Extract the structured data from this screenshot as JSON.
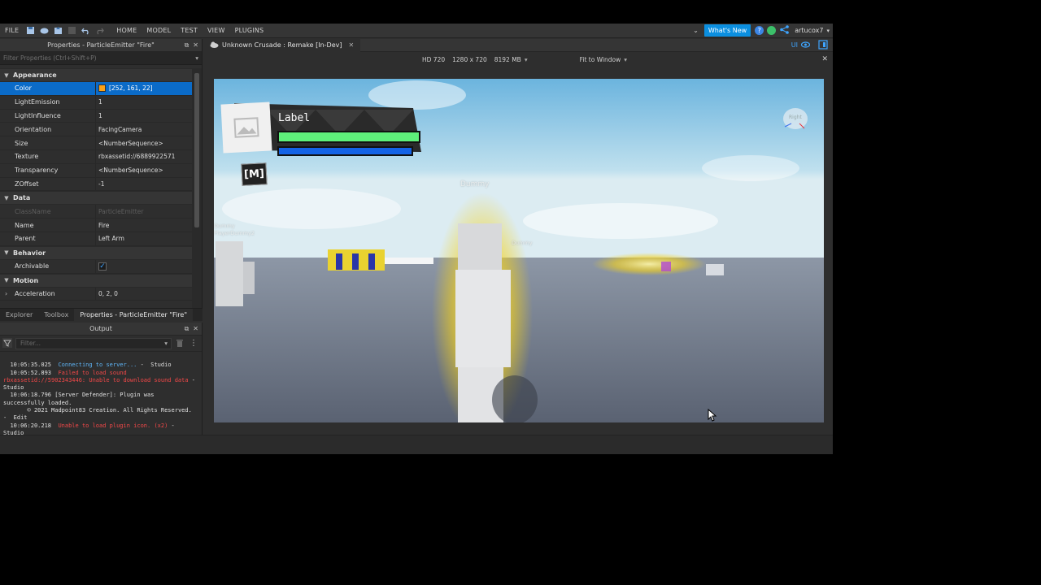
{
  "menu": {
    "file": "FILE",
    "tabs": [
      "HOME",
      "MODEL",
      "TEST",
      "VIEW",
      "PLUGINS"
    ],
    "whats_new": "What's New",
    "user": "artucox7"
  },
  "properties": {
    "title": "Properties - ParticleEmitter \"Fire\"",
    "filter_placeholder": "Filter Properties (Ctrl+Shift+P)",
    "sections": {
      "appearance": "Appearance",
      "data": "Data",
      "behavior": "Behavior",
      "motion": "Motion"
    },
    "appearance_rows": [
      {
        "key": "Color",
        "value": "[252, 161, 22]"
      },
      {
        "key": "LightEmission",
        "value": "1"
      },
      {
        "key": "LightInfluence",
        "value": "1"
      },
      {
        "key": "Orientation",
        "value": "FacingCamera"
      },
      {
        "key": "Size",
        "value": "<NumberSequence>"
      },
      {
        "key": "Texture",
        "value": "rbxassetid://6889922571"
      },
      {
        "key": "Transparency",
        "value": "<NumberSequence>"
      },
      {
        "key": "ZOffset",
        "value": "-1"
      }
    ],
    "data_rows": [
      {
        "key": "ClassName",
        "value": "ParticleEmitter"
      },
      {
        "key": "Name",
        "value": "Fire"
      },
      {
        "key": "Parent",
        "value": "Left Arm"
      }
    ],
    "behavior_rows": [
      {
        "key": "Archivable",
        "value": "✓"
      }
    ],
    "motion_rows": [
      {
        "key": "Acceleration",
        "value": "0, 2, 0"
      }
    ],
    "color_swatch": "#fca116"
  },
  "bottom_tabs": [
    "Explorer",
    "Toolbox",
    "Properties - ParticleEmitter \"Fire\""
  ],
  "output": {
    "title": "Output",
    "filter_placeholder": "Filter...",
    "lines": [
      {
        "time": "10:05:35.025",
        "msg": "Connecting to server...",
        "suffix": " -  Studio",
        "kind": "blue"
      },
      {
        "time": "10:05:52.893",
        "msg": "Failed to load sound rbxassetid://5902343446: Unable to download sound data",
        "suffix": " -  Studio",
        "kind": "red"
      },
      {
        "time": "10:06:18.796",
        "msg": "[Server Defender]: Plugin was successfully loaded.",
        "suffix": "",
        "kind": "normal"
      },
      {
        "time": "",
        "msg": "© 2021 Madpoint83 Creation. All Rights Reserved.",
        "suffix": " -  Edit",
        "kind": "normal"
      },
      {
        "time": "10:06:20.218",
        "msg": "Unable to load plugin icon. (x2)",
        "suffix": " -  Studio",
        "kind": "red"
      }
    ]
  },
  "document": {
    "tab_title": "Unknown Crusade : Remake [In-Dev]",
    "ui_toggle": "UI",
    "resolution": "HD 720",
    "dimensions": "1280 x 720",
    "memory": "8192 MB",
    "fit": "Fit to Window"
  },
  "game": {
    "gui_label": "Label",
    "logo": "[M]",
    "health_fraction": 1.0,
    "mana_fraction": 1.0,
    "nametags": [
      "Dummy",
      "Dummy",
      "PlayerDummy2",
      "Dummy"
    ],
    "viewcube_label": "Right"
  }
}
